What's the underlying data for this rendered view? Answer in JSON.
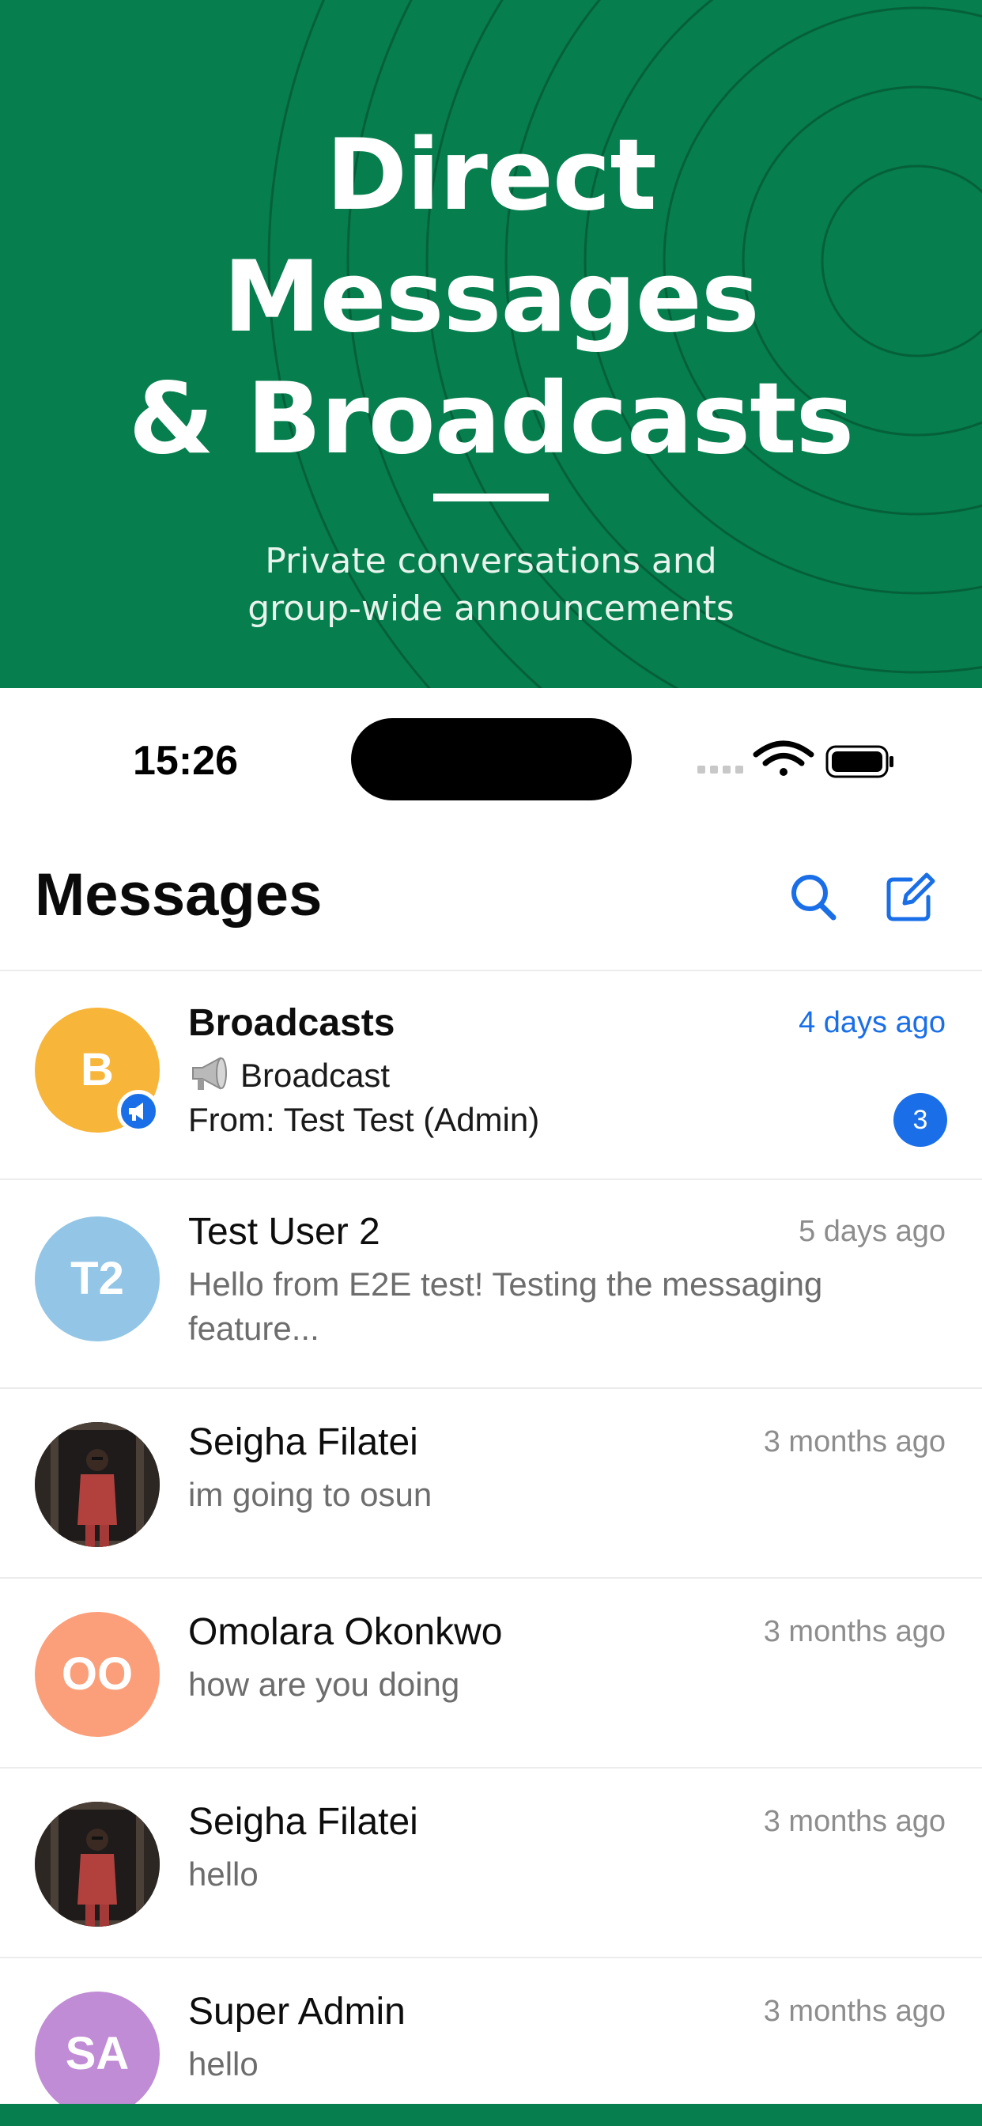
{
  "hero": {
    "title_lines": [
      "Direct",
      "Messages",
      "& Broadcasts"
    ],
    "subtitle_lines": [
      "Private conversations and",
      "group-wide announcements"
    ],
    "background": "#067e4d"
  },
  "status_bar": {
    "time": "15:26",
    "icons": [
      "signal-icon",
      "wifi-icon",
      "battery-icon"
    ]
  },
  "nav": {
    "title": "Messages",
    "search_icon": "search-icon",
    "compose_icon": "compose-icon"
  },
  "accent_color": "#1a6fe8",
  "conversations": [
    {
      "name": "Broadcasts",
      "initials": "B",
      "avatar_color": "#f7b53a",
      "time": "4 days ago",
      "preview_line1": "Broadcast",
      "preview_line2": "From: Test Test (Admin)",
      "unread": "3",
      "icon": "megaphone-icon"
    },
    {
      "name": "Test User 2",
      "initials": "T2",
      "avatar_color": "#93c6e6",
      "time": "5 days ago",
      "preview_line1": "Hello from E2E test! Testing the messaging",
      "preview_line2": "feature..."
    },
    {
      "name": "Seigha Filatei",
      "avatar": "photo",
      "time": "3 months ago",
      "preview_line1": "im going to osun"
    },
    {
      "name": "Omolara Okonkwo",
      "initials": "OO",
      "avatar_color": "#fb9f7b",
      "time": "3 months ago",
      "preview_line1": "how are you doing"
    },
    {
      "name": "Seigha Filatei",
      "avatar": "photo",
      "time": "3 months ago",
      "preview_line1": "hello"
    },
    {
      "name": "Super Admin",
      "initials": "SA",
      "avatar_color": "#c08cd5",
      "time": "3 months ago",
      "preview_line1": "hello"
    }
  ]
}
